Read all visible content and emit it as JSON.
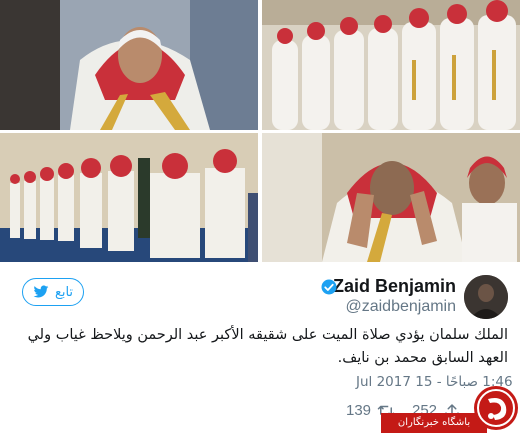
{
  "tweet": {
    "display_name": "Zaid Benjamin",
    "handle": "@zaidbenjamin",
    "follow_label": "تابع",
    "text": "الملك سلمان يؤدي صلاة الميت على شقيقه الأكبر عبد الرحمن ويلاحظ غياب ولي العهد السابق محمد بن نايف.",
    "timestamp": "1:46 صباحًا - 15 Jul 2017",
    "retweet_count": "139",
    "like_count": "252",
    "verified": true
  },
  "watermark": {
    "text": "باشگاه خبرنگاران"
  },
  "icons": [
    "twitter-bird-icon",
    "verified-badge-icon",
    "retweet-icon",
    "heart-icon",
    "share-icon"
  ],
  "colors": {
    "accent": "#1da1f2",
    "text": "#14171a",
    "muted": "#657786",
    "watermark_red": "#c41a16"
  }
}
